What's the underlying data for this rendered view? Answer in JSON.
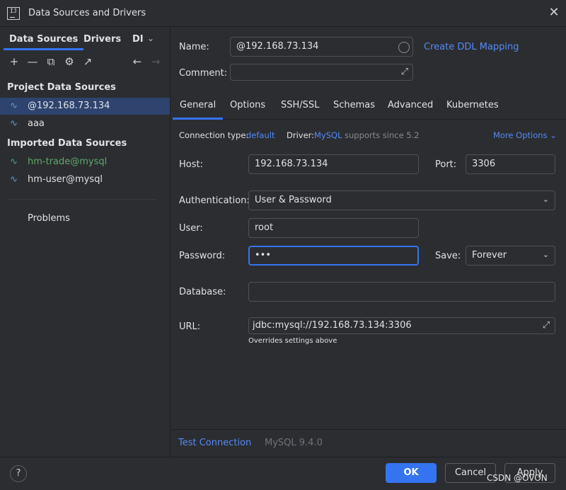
{
  "window": {
    "title": "Data Sources and Drivers",
    "app_icon_text": "IJ"
  },
  "sidebar": {
    "tabs": [
      "Data Sources",
      "Drivers",
      "DI"
    ],
    "groups": {
      "project": "Project Data Sources",
      "imported": "Imported Data Sources"
    },
    "project_items": [
      "@192.168.73.134",
      "aaa"
    ],
    "imported_items": [
      "hm-trade@mysql",
      "hm-user@mysql"
    ],
    "problems": "Problems"
  },
  "form": {
    "name_label": "Name:",
    "name_value": "@192.168.73.134",
    "create_ddl": "Create DDL Mapping",
    "comment_label": "Comment:",
    "comment_value": "",
    "tabs": [
      "General",
      "Options",
      "SSH/SSL",
      "Schemas",
      "Advanced",
      "Kubernetes"
    ],
    "connection_type_label": "Connection type:",
    "connection_type_value": "default",
    "driver_label": "Driver:",
    "driver_value": "MySQL",
    "driver_note": "supports since 5.2",
    "more_options": "More Options",
    "host_label": "Host:",
    "host_value": "192.168.73.134",
    "port_label": "Port:",
    "port_value": "3306",
    "auth_label": "Authentication:",
    "auth_value": "User & Password",
    "user_label": "User:",
    "user_value": "root",
    "password_label": "Password:",
    "password_value": "•••",
    "save_label": "Save:",
    "save_value": "Forever",
    "database_label": "Database:",
    "database_value": "",
    "url_label": "URL:",
    "url_value": "jdbc:mysql://192.168.73.134:3306",
    "url_hint": "Overrides settings above",
    "test_connection": "Test Connection",
    "driver_version": "MySQL 9.4.0"
  },
  "footer": {
    "help": "?",
    "ok": "OK",
    "cancel": "Cancel",
    "apply": "Apply",
    "watermark": "CSDN @OVON"
  },
  "colors": {
    "accent": "#3574f0",
    "link": "#548af7",
    "selected_row": "#2e436e",
    "background": "#2b2d30"
  }
}
